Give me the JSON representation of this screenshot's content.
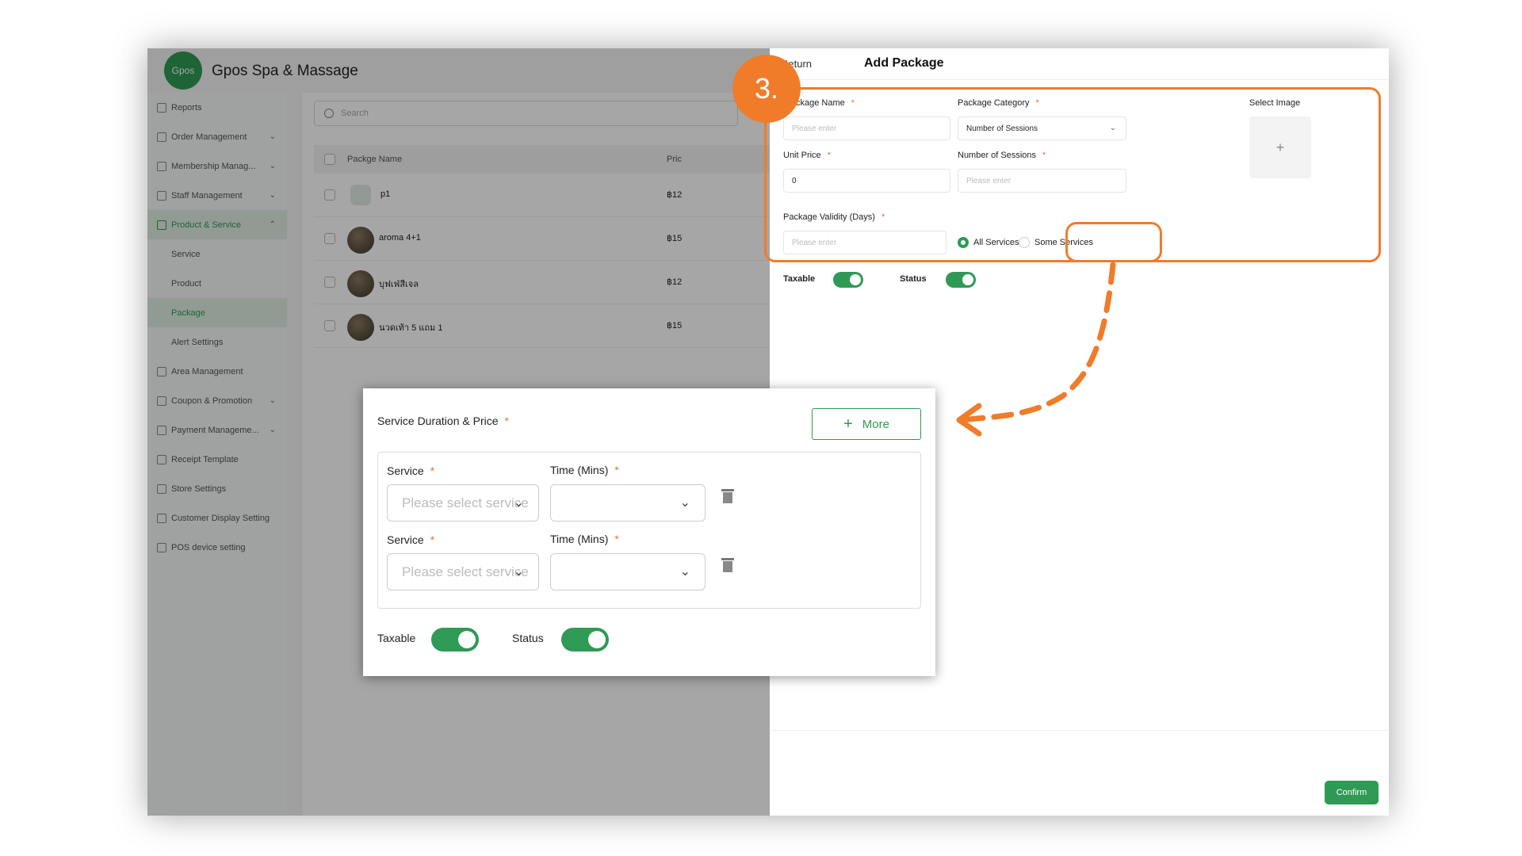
{
  "step_badge": "3.",
  "app": {
    "logo_text": "Gpos",
    "title": "Gpos Spa & Massage",
    "sidebar": [
      {
        "label": "Reports",
        "chevron": ""
      },
      {
        "label": "Order Management",
        "chevron": "⌄"
      },
      {
        "label": "Membership Manag...",
        "chevron": "⌄"
      },
      {
        "label": "Staff Management",
        "chevron": "⌄"
      },
      {
        "label": "Product & Service",
        "chevron": "⌃"
      },
      {
        "label": "Service",
        "chevron": ""
      },
      {
        "label": "Product",
        "chevron": ""
      },
      {
        "label": "Package",
        "chevron": ""
      },
      {
        "label": "Alert Settings",
        "chevron": ""
      },
      {
        "label": "Area Management",
        "chevron": ""
      },
      {
        "label": "Coupon & Promotion",
        "chevron": "⌄"
      },
      {
        "label": "Payment Manageme...",
        "chevron": "⌄"
      },
      {
        "label": "Receipt Template",
        "chevron": ""
      },
      {
        "label": "Store Settings",
        "chevron": ""
      },
      {
        "label": "Customer Display Setting",
        "chevron": ""
      },
      {
        "label": "POS device setting",
        "chevron": ""
      }
    ],
    "search_placeholder": "Search",
    "table_header": {
      "name": "Packge Name",
      "price": "Pric"
    },
    "rows": [
      {
        "name": "p1",
        "price": "฿12"
      },
      {
        "name": "aroma 4+1",
        "price": "฿15"
      },
      {
        "name": "บุฟเฟ่สีเจล",
        "price": "฿12"
      },
      {
        "name": "นวดเท้า 5 แถม 1",
        "price": "฿15"
      }
    ]
  },
  "drawer": {
    "return_label": "Return",
    "title": "Add Package",
    "package_name_label": "ckage Name",
    "package_name_placeholder": "Please enter",
    "package_category_label": "Package Category",
    "package_category_value": "Number of Sessions",
    "select_image_label": "Select Image",
    "image_plus": "+",
    "unit_price_label": "Unit Price",
    "unit_price_value": "0",
    "sessions_label": "Number of Sessions",
    "sessions_placeholder": "Please enter",
    "validity_label": "Package Validity (Days)",
    "validity_placeholder": "Please enter",
    "all_services_label": "All Services",
    "some_services_label": "Some Services",
    "taxable_label": "Taxable",
    "status_label": "Status",
    "confirm_label": "Confirm",
    "required_mark": "*"
  },
  "zoom": {
    "title": "Service Duration & Price",
    "more_label": "More",
    "more_plus": "+",
    "rows": [
      {
        "service_label": "Service",
        "service_placeholder": "Please select service",
        "time_label": "Time (Mins)"
      },
      {
        "service_label": "Service",
        "service_placeholder": "Please select service",
        "time_label": "Time (Mins)"
      }
    ],
    "taxable_label": "Taxable",
    "status_label": "Status"
  },
  "colors": {
    "accent_green": "#2f9a55",
    "highlight_orange": "#f07c2a"
  }
}
